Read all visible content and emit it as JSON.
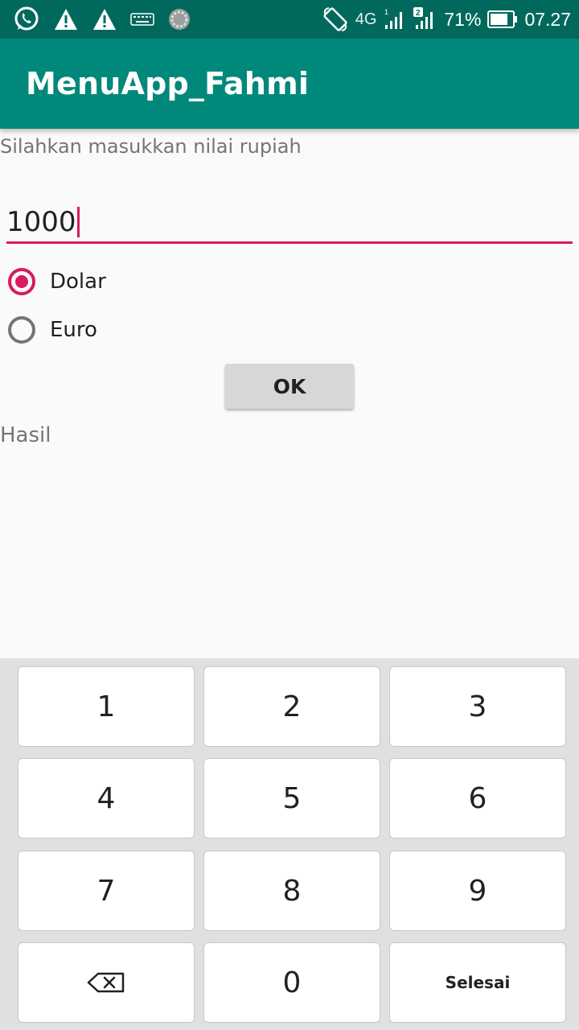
{
  "status_bar": {
    "icons": [
      "whatsapp-icon",
      "warning-icon",
      "warning-icon",
      "keyboard-icon",
      "sync-icon",
      "rotate-icon",
      "signal-icon",
      "signal-icon"
    ],
    "network": "4G",
    "sim1_label": "1",
    "sim2_label": "2",
    "battery": "71%",
    "time": "07.27"
  },
  "app_bar": {
    "title": "MenuApp_Fahmi"
  },
  "form": {
    "prompt": "Silahkan masukkan nilai rupiah",
    "amount_value": "1000",
    "currency_options": [
      {
        "label": "Dolar",
        "selected": true
      },
      {
        "label": "Euro",
        "selected": false
      }
    ],
    "ok_label": "OK",
    "result_label": "Hasil"
  },
  "keypad": {
    "keys": [
      "1",
      "2",
      "3",
      "4",
      "5",
      "6",
      "7",
      "8",
      "9",
      "",
      "0",
      "Selesai"
    ],
    "backspace_icon": "backspace-icon"
  },
  "colors": {
    "status_bar": "#00695c",
    "app_bar": "#00897b",
    "accent": "#d81b60",
    "background": "#fafafa",
    "keypad_bg": "#e0e0e0"
  }
}
